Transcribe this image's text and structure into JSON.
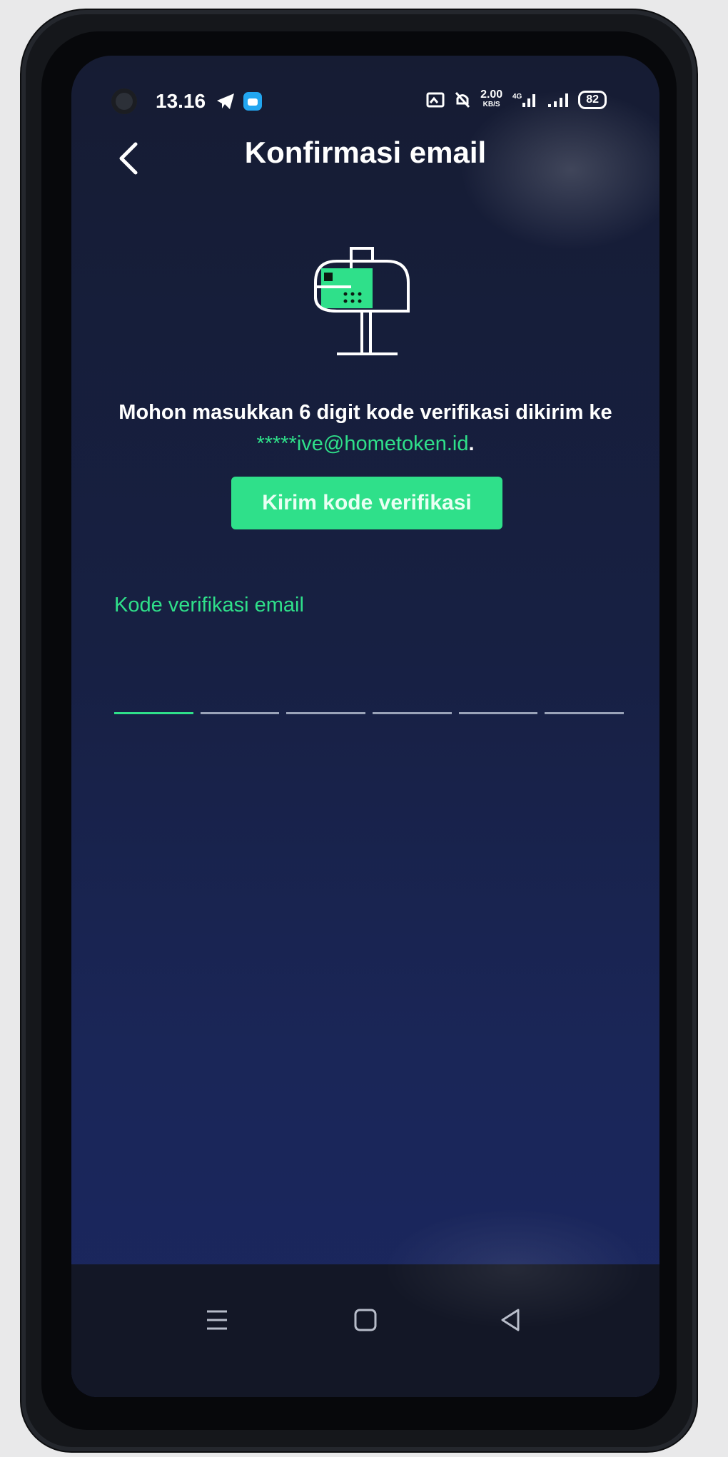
{
  "status_bar": {
    "time": "13.16",
    "network_speed": "2.00",
    "network_unit": "KB/S",
    "battery": "82"
  },
  "header": {
    "title": "Konfirmasi email"
  },
  "main": {
    "message_text": "Mohon masukkan 6 digit kode verifikasi dikirim ke",
    "email": "*****ive@hometoken.id",
    "email_suffix": ".",
    "send_button_label": "Kirim kode verifikasi",
    "code_label": "Kode verifikasi email",
    "code_digits": [
      "",
      "",
      "",
      "",
      "",
      ""
    ]
  },
  "colors": {
    "accent": "#2fe08a",
    "background": "#172043",
    "text": "#ffffff"
  },
  "icons": {
    "back": "chevron-left-icon",
    "illustration": "mailbox-icon",
    "nav_menu": "menu-icon",
    "nav_home": "home-icon",
    "nav_back": "triangle-back-icon"
  }
}
